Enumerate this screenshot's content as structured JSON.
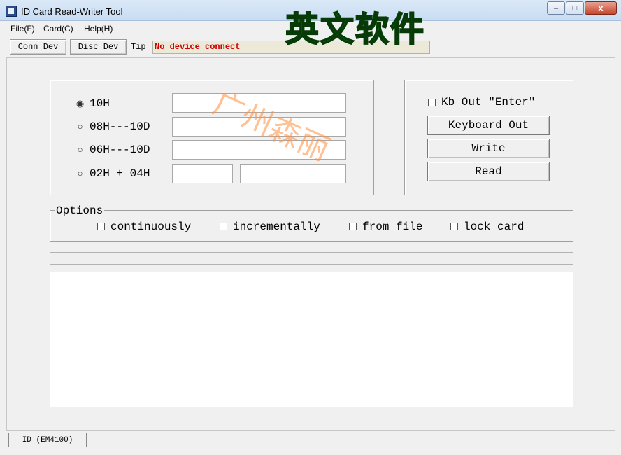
{
  "window": {
    "title": "ID Card Read-Writer Tool",
    "minimize": "–",
    "maximize": "□",
    "close": "x"
  },
  "menu": [
    "File(F)",
    "Card(C)",
    "Help(H)"
  ],
  "toolbar": {
    "connect": "Conn Dev",
    "disconnect": "Disc Dev",
    "tip_label": "Tip",
    "tip_value": "No device connect"
  },
  "format_group": {
    "options": [
      {
        "label": "10H",
        "selected": true
      },
      {
        "label": "08H---10D",
        "selected": false
      },
      {
        "label": "06H---10D",
        "selected": false
      },
      {
        "label": "02H + 04H",
        "selected": false
      }
    ]
  },
  "actions": {
    "kb_enter_label": "Kb Out \"Enter\"",
    "keyboard_out": "Keyboard Out",
    "write": "Write",
    "read": "Read"
  },
  "options": {
    "title": "Options",
    "items": [
      "continuously",
      "incrementally",
      "from file",
      "lock card"
    ]
  },
  "tabs": [
    "ID (EM4100)"
  ],
  "overlay": {
    "banner": "英文软件",
    "watermark": "广州森丽"
  },
  "colors": {
    "tip_text": "#d00000",
    "banner": "#0d8a0d",
    "watermark": "#ff8c3c"
  }
}
